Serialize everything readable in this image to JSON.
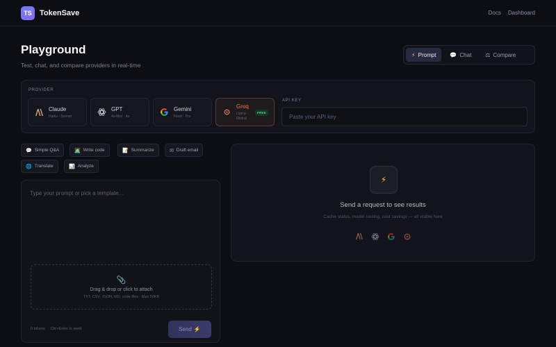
{
  "app": {
    "logo_initials": "TS",
    "name": "TokenSave",
    "nav": [
      "Docs",
      "Dashboard"
    ]
  },
  "page": {
    "title": "Playground",
    "subtitle": "Test, chat, and compare providers in real-time"
  },
  "modes": [
    {
      "label": "Prompt",
      "icon": "lightning-icon",
      "active": true
    },
    {
      "label": "Chat",
      "icon": "speech-bubble-icon",
      "active": false
    },
    {
      "label": "Compare",
      "icon": "balance-scale-icon",
      "active": false
    }
  ],
  "provider": {
    "section_label": "PROVIDER",
    "items": [
      {
        "name": "Claude",
        "models": "Haiku · Sonnet",
        "icon": "anthropic-icon",
        "selected": false
      },
      {
        "name": "GPT",
        "models": "4o-Mini · 4o",
        "icon": "openai-icon",
        "selected": false
      },
      {
        "name": "Gemini",
        "models": "Flash · Pro",
        "icon": "google-icon",
        "selected": false
      },
      {
        "name": "Groq",
        "models_line1": "Llama ·",
        "models_line2": "Mistral",
        "badge": "FREE",
        "icon": "groq-icon",
        "selected": true
      }
    ],
    "api_key_label": "API KEY",
    "api_key_placeholder": "Paste your API key",
    "api_key_value": ""
  },
  "templates": [
    {
      "label": "Simple Q&A",
      "icon": "speech-bubble-icon"
    },
    {
      "label": "Write code",
      "icon": "technologist-icon"
    },
    {
      "label": "Summarize",
      "icon": "memo-icon"
    },
    {
      "label": "Draft email",
      "icon": "envelope-icon"
    },
    {
      "label": "Translate",
      "icon": "globe-icon"
    },
    {
      "label": "Analyze",
      "icon": "bar-chart-icon"
    }
  ],
  "prompt": {
    "placeholder": "Type your prompt or pick a template...",
    "value": "",
    "dropzone_main": "Drag & drop or click to attach",
    "dropzone_sub": "TXT, CSV, JSON, MD, code files · Max 50KB",
    "token_count": "0 tokens",
    "shortcut_hint": "Ctrl+Enter to send",
    "send_label": "Send",
    "send_icon": "lightning-icon"
  },
  "results": {
    "icon": "lightning-icon",
    "title": "Send a request to see results",
    "subtitle": "Cache status, model routing, cost savings — all visible here",
    "provider_icons": [
      "anthropic-icon",
      "openai-icon",
      "google-icon",
      "groq-icon"
    ]
  },
  "colors": {
    "background": "#0d0e13",
    "accent": "#6f7cf5",
    "groq_orange": "#ee7f5e",
    "free_green": "#4ad08a"
  }
}
